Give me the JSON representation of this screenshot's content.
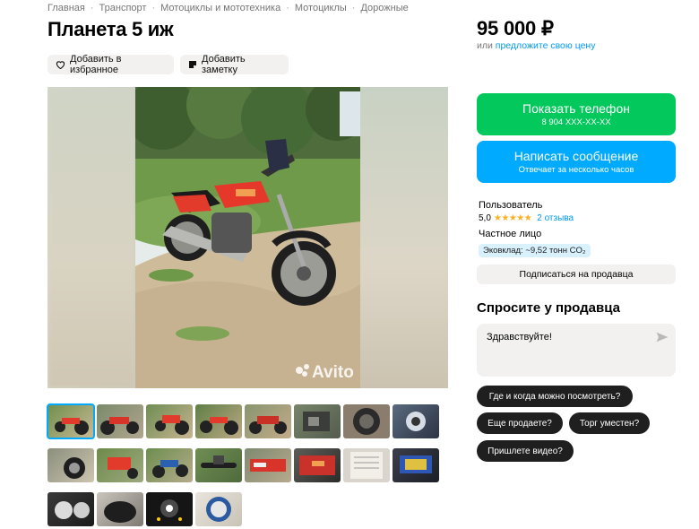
{
  "breadcrumbs": [
    "Главная",
    "Транспорт",
    "Мотоциклы и мототехника",
    "Мотоциклы",
    "Дорожные"
  ],
  "breadcrumb_separator": "·",
  "title": "Планета 5 иж",
  "actions": {
    "favorite_label": "Добавить в избранное",
    "note_label": "Добавить заметку"
  },
  "gallery": {
    "watermark": "Avito"
  },
  "price": {
    "value": "95 000 ₽",
    "alt_prefix": "или",
    "alt_link": "предложите свою цену"
  },
  "contact": {
    "phone_label": "Показать телефон",
    "phone_masked": "8 904 XXX-XX-XX",
    "message_label": "Написать сообщение",
    "message_sub": "Отвечает за несколько часов"
  },
  "seller": {
    "name": "Пользователь",
    "rating": "5,0",
    "stars": "★★★★★",
    "reviews": "2 отзыва",
    "type": "Частное лицо",
    "eco": "Эковклад: ~9,52 тонн CO₂",
    "subscribe_label": "Подписаться на продавца"
  },
  "ask": {
    "title": "Спросите у продавца",
    "message": "Здравствуйте!",
    "chips": [
      "Где и когда можно посмотреть?",
      "Еще продаете?",
      "Торг уместен?",
      "Пришлете видео?"
    ]
  },
  "colors": {
    "accent_blue": "#00aaff",
    "accent_green": "#03c95c",
    "link_blue": "#0099f7",
    "star": "#ffb021"
  },
  "icons": [
    "heart-icon",
    "note-icon",
    "send-icon"
  ]
}
